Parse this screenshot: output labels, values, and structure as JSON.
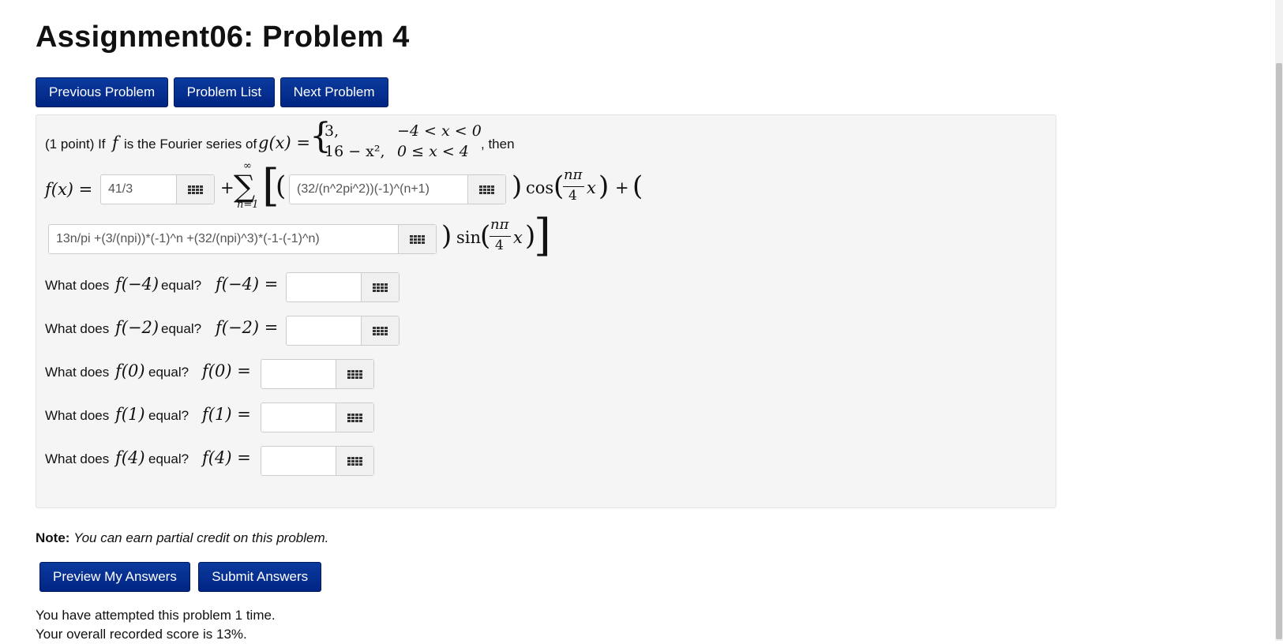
{
  "page": {
    "title": "Assignment06: Problem 4"
  },
  "nav": {
    "previous": "Previous Problem",
    "list": "Problem List",
    "next": "Next Problem"
  },
  "problem": {
    "points": "(1 point) If",
    "is_fourier": "is the Fourier series of",
    "then": ", then",
    "f": "f",
    "g_of_x": "g(x) =",
    "piece1_expr": "3,",
    "piece1_cond": "−4 < x < 0",
    "piece2_expr": "16 − x²,",
    "piece2_cond": "0 ≤ x < 4",
    "f_of_x": "f(x) =",
    "a0_value": "41/3",
    "sum_upper": "∞",
    "sum_lower": "n=1",
    "an_value": "(32/(n^2pi^2))(-1)^(n+1)",
    "cos": "cos",
    "sin": "sin",
    "n_pi": "nπ",
    "four": "4",
    "x": "x",
    "bn_value": "13n/pi +(3/(npi))*(-1)^n +(32/(npi)^3)*(-1-(-1)^n)",
    "questions": [
      {
        "prefix": "What does",
        "arg": "f(−4)",
        "suffix": "equal?",
        "lhs": "f(−4) =",
        "value": ""
      },
      {
        "prefix": "What does",
        "arg": "f(−2)",
        "suffix": "equal?",
        "lhs": "f(−2) =",
        "value": ""
      },
      {
        "prefix": "What does",
        "arg": "f(0)",
        "suffix": "equal?",
        "lhs": "f(0) =",
        "value": ""
      },
      {
        "prefix": "What does",
        "arg": "f(1)",
        "suffix": "equal?",
        "lhs": "f(1) =",
        "value": ""
      },
      {
        "prefix": "What does",
        "arg": "f(4)",
        "suffix": "equal?",
        "lhs": "f(4) =",
        "value": ""
      }
    ]
  },
  "note": {
    "label": "Note:",
    "text": "You can earn partial credit on this problem."
  },
  "actions": {
    "preview": "Preview My Answers",
    "submit": "Submit Answers"
  },
  "status": {
    "attempts": "You have attempted this problem 1 time.",
    "score": "Your overall recorded score is 13%."
  },
  "icons": {
    "keyboard": "equation-editor-grid-icon"
  },
  "colors": {
    "button": "#002583",
    "panel": "#f5f5f5"
  }
}
